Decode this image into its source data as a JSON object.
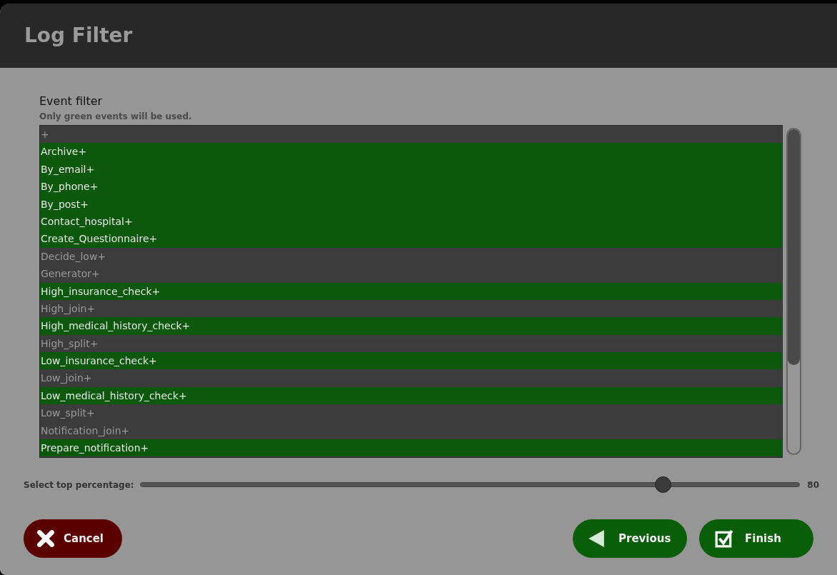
{
  "window": {
    "title": "Log Filter"
  },
  "filter": {
    "title": "Event filter",
    "hint": "Only green events will be used.",
    "events": [
      {
        "label": "+",
        "selected": false
      },
      {
        "label": "Archive+",
        "selected": true
      },
      {
        "label": "By_email+",
        "selected": true
      },
      {
        "label": "By_phone+",
        "selected": true
      },
      {
        "label": "By_post+",
        "selected": true
      },
      {
        "label": "Contact_hospital+",
        "selected": true
      },
      {
        "label": "Create_Questionnaire+",
        "selected": true
      },
      {
        "label": "Decide_low+",
        "selected": false
      },
      {
        "label": "Generator+",
        "selected": false
      },
      {
        "label": "High_insurance_check+",
        "selected": true
      },
      {
        "label": "High_join+",
        "selected": false
      },
      {
        "label": "High_medical_history_check+",
        "selected": true
      },
      {
        "label": "High_split+",
        "selected": false
      },
      {
        "label": "Low_insurance_check+",
        "selected": true
      },
      {
        "label": "Low_join+",
        "selected": false
      },
      {
        "label": "Low_medical_history_check+",
        "selected": true
      },
      {
        "label": "Low_split+",
        "selected": false
      },
      {
        "label": "Notification_join+",
        "selected": false
      },
      {
        "label": "Prepare_notification+",
        "selected": true
      }
    ]
  },
  "slider": {
    "label": "Select top percentage:",
    "level": 0.8,
    "reading": "80"
  },
  "buttons": [
    {
      "kind": "cancel",
      "label": "Cancel"
    },
    {
      "kind": "previous",
      "label": "Previous"
    },
    {
      "kind": "finish",
      "label": "Finish"
    }
  ]
}
